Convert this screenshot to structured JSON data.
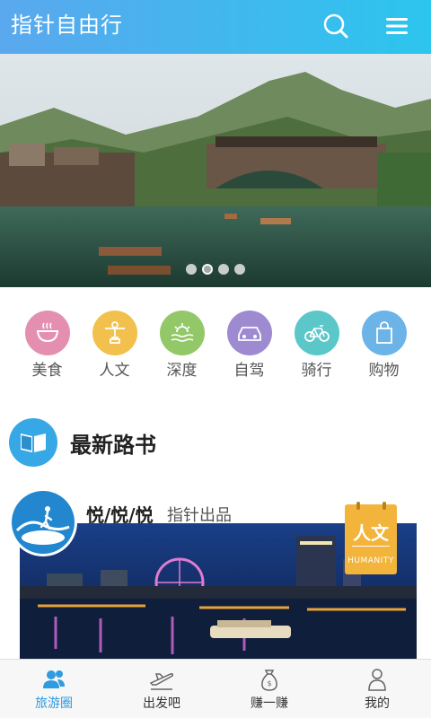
{
  "header": {
    "title": "指针自由行",
    "search_icon": "search-icon",
    "menu_icon": "menu-icon"
  },
  "banner": {
    "slide_count": 4,
    "active_slide": 2
  },
  "categories": [
    {
      "label": "美食",
      "icon": "food-bowl-icon",
      "color": "#e58fb0"
    },
    {
      "label": "人文",
      "icon": "statue-icon",
      "color": "#f2c04c"
    },
    {
      "label": "深度",
      "icon": "sunrise-sea-icon",
      "color": "#93c869"
    },
    {
      "label": "自驾",
      "icon": "car-icon",
      "color": "#9d8ad1"
    },
    {
      "label": "骑行",
      "icon": "bicycle-icon",
      "color": "#5cc7c9"
    },
    {
      "label": "购物",
      "icon": "shopping-bag-icon",
      "color": "#6cb3e7"
    }
  ],
  "section": {
    "title": "最新路书",
    "icon": "open-book-icon"
  },
  "card": {
    "title": "悦/悦/悦",
    "by": "指针出品",
    "badge_main": "人文",
    "badge_sub": "HUMANITY"
  },
  "nav": [
    {
      "label": "旅游圈",
      "icon": "people-icon",
      "active": true
    },
    {
      "label": "出发吧",
      "icon": "airplane-icon",
      "active": false
    },
    {
      "label": "赚一赚",
      "icon": "money-bag-icon",
      "active": false
    },
    {
      "label": "我的",
      "icon": "person-icon",
      "active": false
    }
  ],
  "colors": {
    "header_start": "#5aa8ee",
    "header_end": "#2cc5ee",
    "nav_active": "#2f9be0",
    "badge": "#f2b43a"
  }
}
